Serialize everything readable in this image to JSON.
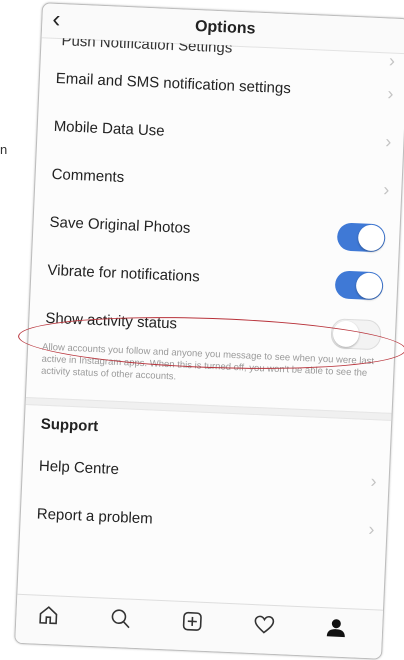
{
  "edge_text": "n",
  "header": {
    "title": "Options"
  },
  "rows": {
    "push_notifications": "Push Notification Settings",
    "email_sms": "Email and SMS notification settings",
    "mobile_data": "Mobile Data Use",
    "comments": "Comments",
    "save_photos": "Save Original Photos",
    "vibrate": "Vibrate for notifications",
    "activity_status": "Show activity status"
  },
  "toggles": {
    "save_photos": true,
    "vibrate": true,
    "activity_status": false
  },
  "activity_hint": "Allow accounts you follow and anyone you message to see when you were last active in Instagram apps. When this is turned off, you won't be able to see the activity status of other accounts.",
  "support": {
    "title": "Support",
    "help_centre": "Help Centre",
    "report_problem": "Report a problem"
  },
  "tab_bar": {
    "icons": [
      "home-icon",
      "search-icon",
      "add-post-icon",
      "heart-icon",
      "profile-icon"
    ]
  },
  "colors": {
    "toggle_on": "#3f79d6",
    "annotation": "#b8323a"
  }
}
